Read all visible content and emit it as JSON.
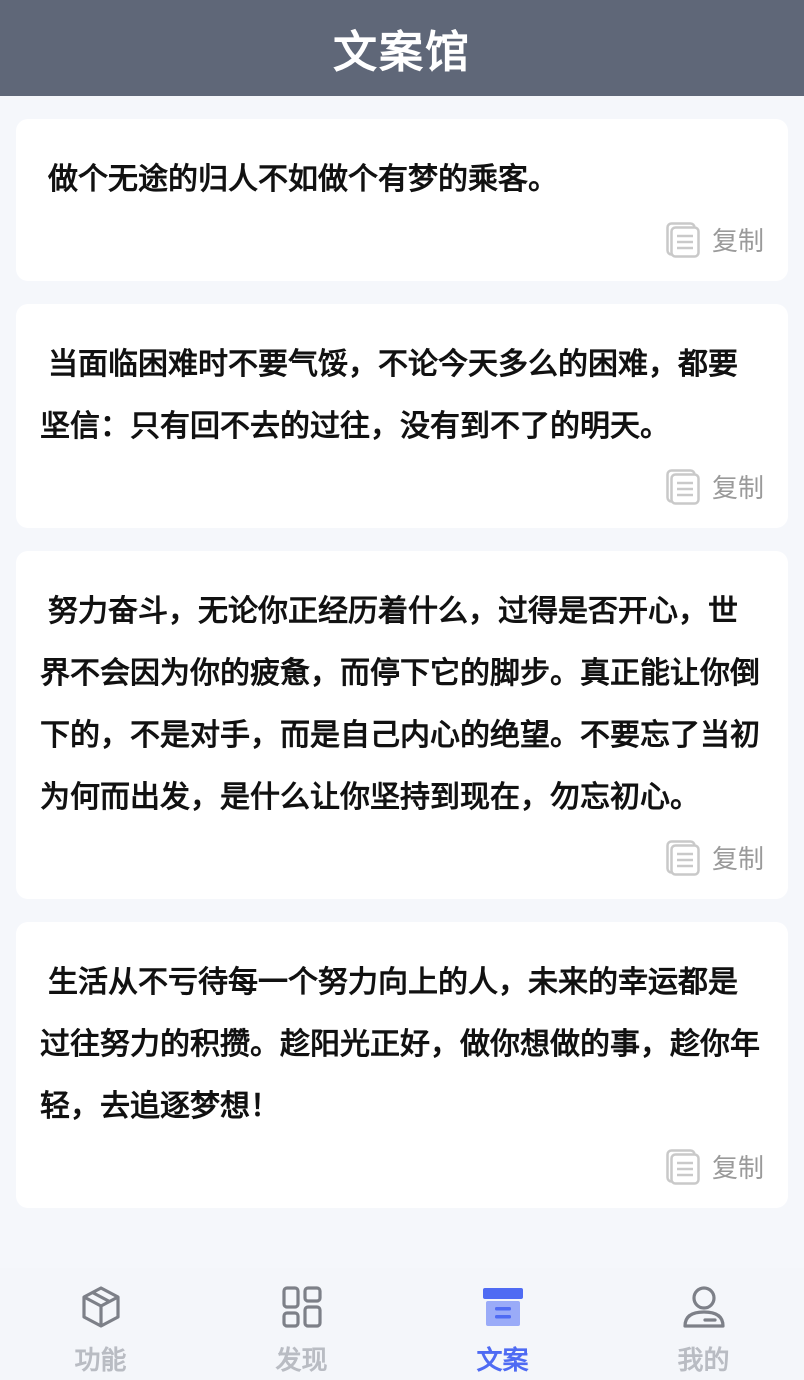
{
  "header": {
    "title": "文案馆"
  },
  "posts": [
    {
      "text": "做个无途的归人不如做个有梦的乘客。",
      "copy_label": "复制"
    },
    {
      "text": "当面临困难时不要气馁，不论今天多么的困难，都要坚信：只有回不去的过往，没有到不了的明天。",
      "copy_label": "复制"
    },
    {
      "text": "努力奋斗，无论你正经历着什么，过得是否开心，世界不会因为你的疲惫，而停下它的脚步。真正能让你倒下的，不是对手，而是自己内心的绝望。不要忘了当初为何而出发，是什么让你坚持到现在，勿忘初心。",
      "copy_label": "复制"
    },
    {
      "text": "生活从不亏待每一个努力向上的人，未来的幸运都是过往努力的积攒。趁阳光正好，做你想做的事，趁你年轻，去追逐梦想！",
      "copy_label": "复制"
    }
  ],
  "tabbar": {
    "active_color": "#4f6bf3",
    "items": [
      {
        "label": "功能",
        "icon": "cube-icon",
        "active": false
      },
      {
        "label": "发现",
        "icon": "grid-icon",
        "active": false
      },
      {
        "label": "文案",
        "icon": "archive-icon",
        "active": true
      },
      {
        "label": "我的",
        "icon": "user-icon",
        "active": false
      }
    ]
  }
}
